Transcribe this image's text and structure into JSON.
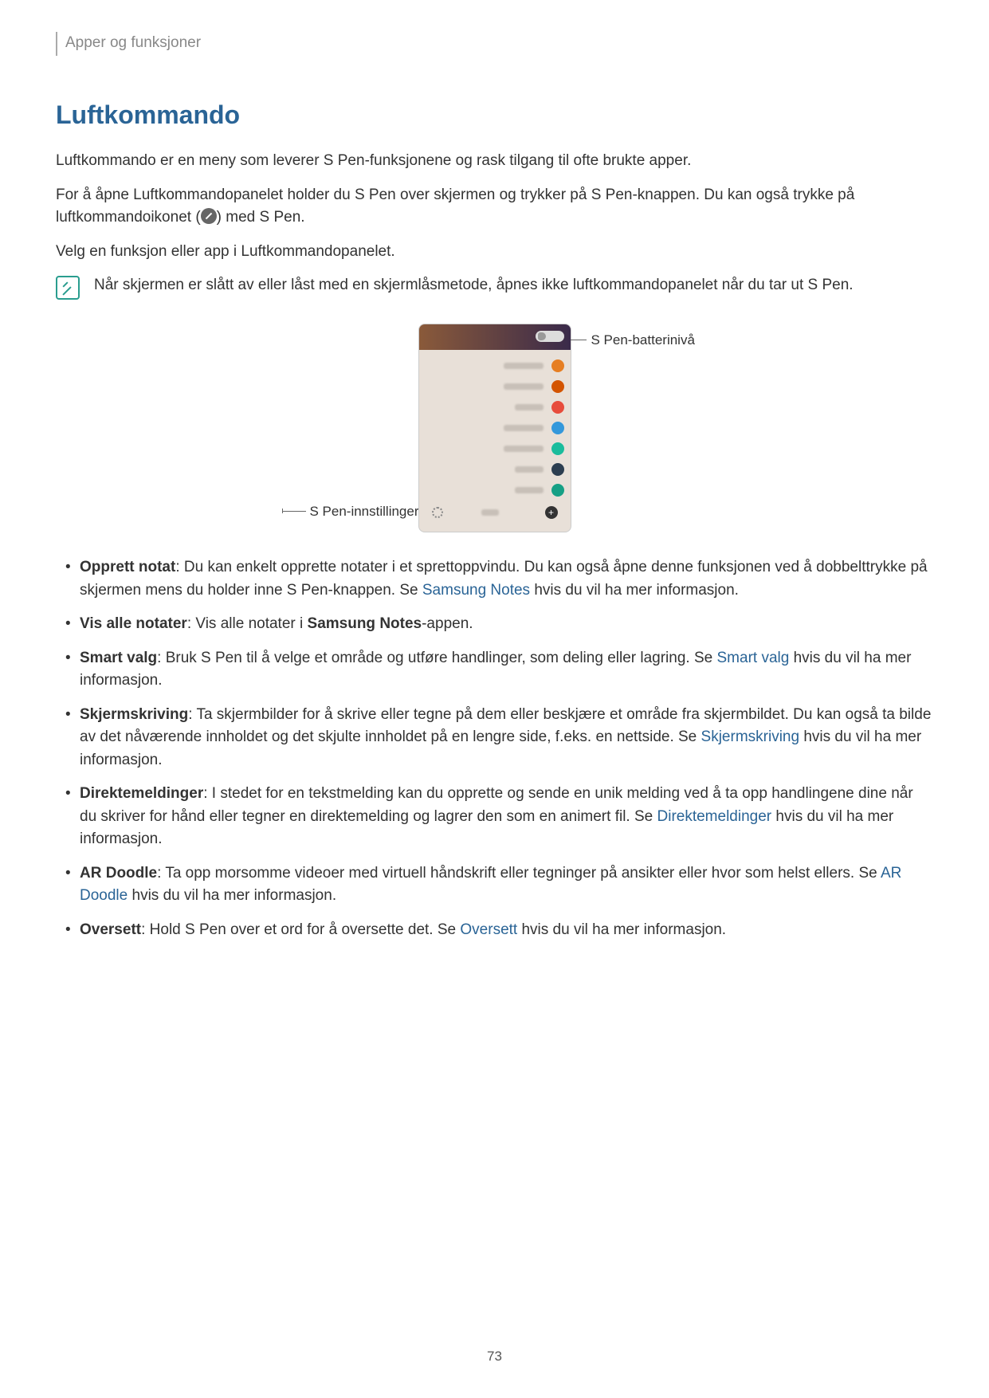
{
  "header": {
    "section": "Apper og funksjoner"
  },
  "heading": "Luftkommando",
  "para1": "Luftkommando er en meny som leverer S Pen-funksjonene og rask tilgang til ofte brukte apper.",
  "para2_a": "For å åpne Luftkommandopanelet holder du S Pen over skjermen og trykker på S Pen-knappen. Du kan også trykke på luftkommandoikonet (",
  "para2_b": ") med S Pen.",
  "para3": "Velg en funksjon eller app i Luftkommandopanelet.",
  "note": "Når skjermen er slått av eller låst med en skjermlåsmetode, åpnes ikke luftkommandopanelet når du tar ut S Pen.",
  "callouts": {
    "right": "S Pen-batterinivå",
    "left": "S Pen-innstillinger"
  },
  "bullets": [
    {
      "bold": "Opprett notat",
      "text_a": ": Du kan enkelt opprette notater i et sprettoppvindu. Du kan også åpne denne funksjonen ved å dobbelttrykke på skjermen mens du holder inne S Pen-knappen. Se ",
      "link": "Samsung Notes",
      "text_b": " hvis du vil ha mer informasjon."
    },
    {
      "bold": "Vis alle notater",
      "text_a": ": Vis alle notater i ",
      "bold2": "Samsung Notes",
      "text_b": "-appen."
    },
    {
      "bold": "Smart valg",
      "text_a": ": Bruk S Pen til å velge et område og utføre handlinger, som deling eller lagring. Se ",
      "link": "Smart valg",
      "text_b": " hvis du vil ha mer informasjon."
    },
    {
      "bold": "Skjermskriving",
      "text_a": ": Ta skjermbilder for å skrive eller tegne på dem eller beskjære et område fra skjermbildet. Du kan også ta bilde av det nåværende innholdet og det skjulte innholdet på en lengre side, f.eks. en nettside. Se ",
      "link": "Skjermskriving",
      "text_b": " hvis du vil ha mer informasjon."
    },
    {
      "bold": "Direktemeldinger",
      "text_a": ": I stedet for en tekstmelding kan du opprette og sende en unik melding ved å ta opp handlingene dine når du skriver for hånd eller tegner en direktemelding og lagrer den som en animert fil. Se ",
      "link": "Direktemeldinger",
      "text_b": " hvis du vil ha mer informasjon."
    },
    {
      "bold": "AR Doodle",
      "text_a": ": Ta opp morsomme videoer med virtuell håndskrift eller tegninger på ansikter eller hvor som helst ellers. Se ",
      "link": "AR Doodle",
      "text_b": " hvis du vil ha mer informasjon."
    },
    {
      "bold": "Oversett",
      "text_a": ": Hold S Pen over et ord for å oversette det. Se ",
      "link": "Oversett",
      "text_b": " hvis du vil ha mer informasjon."
    }
  ],
  "page_number": "73"
}
